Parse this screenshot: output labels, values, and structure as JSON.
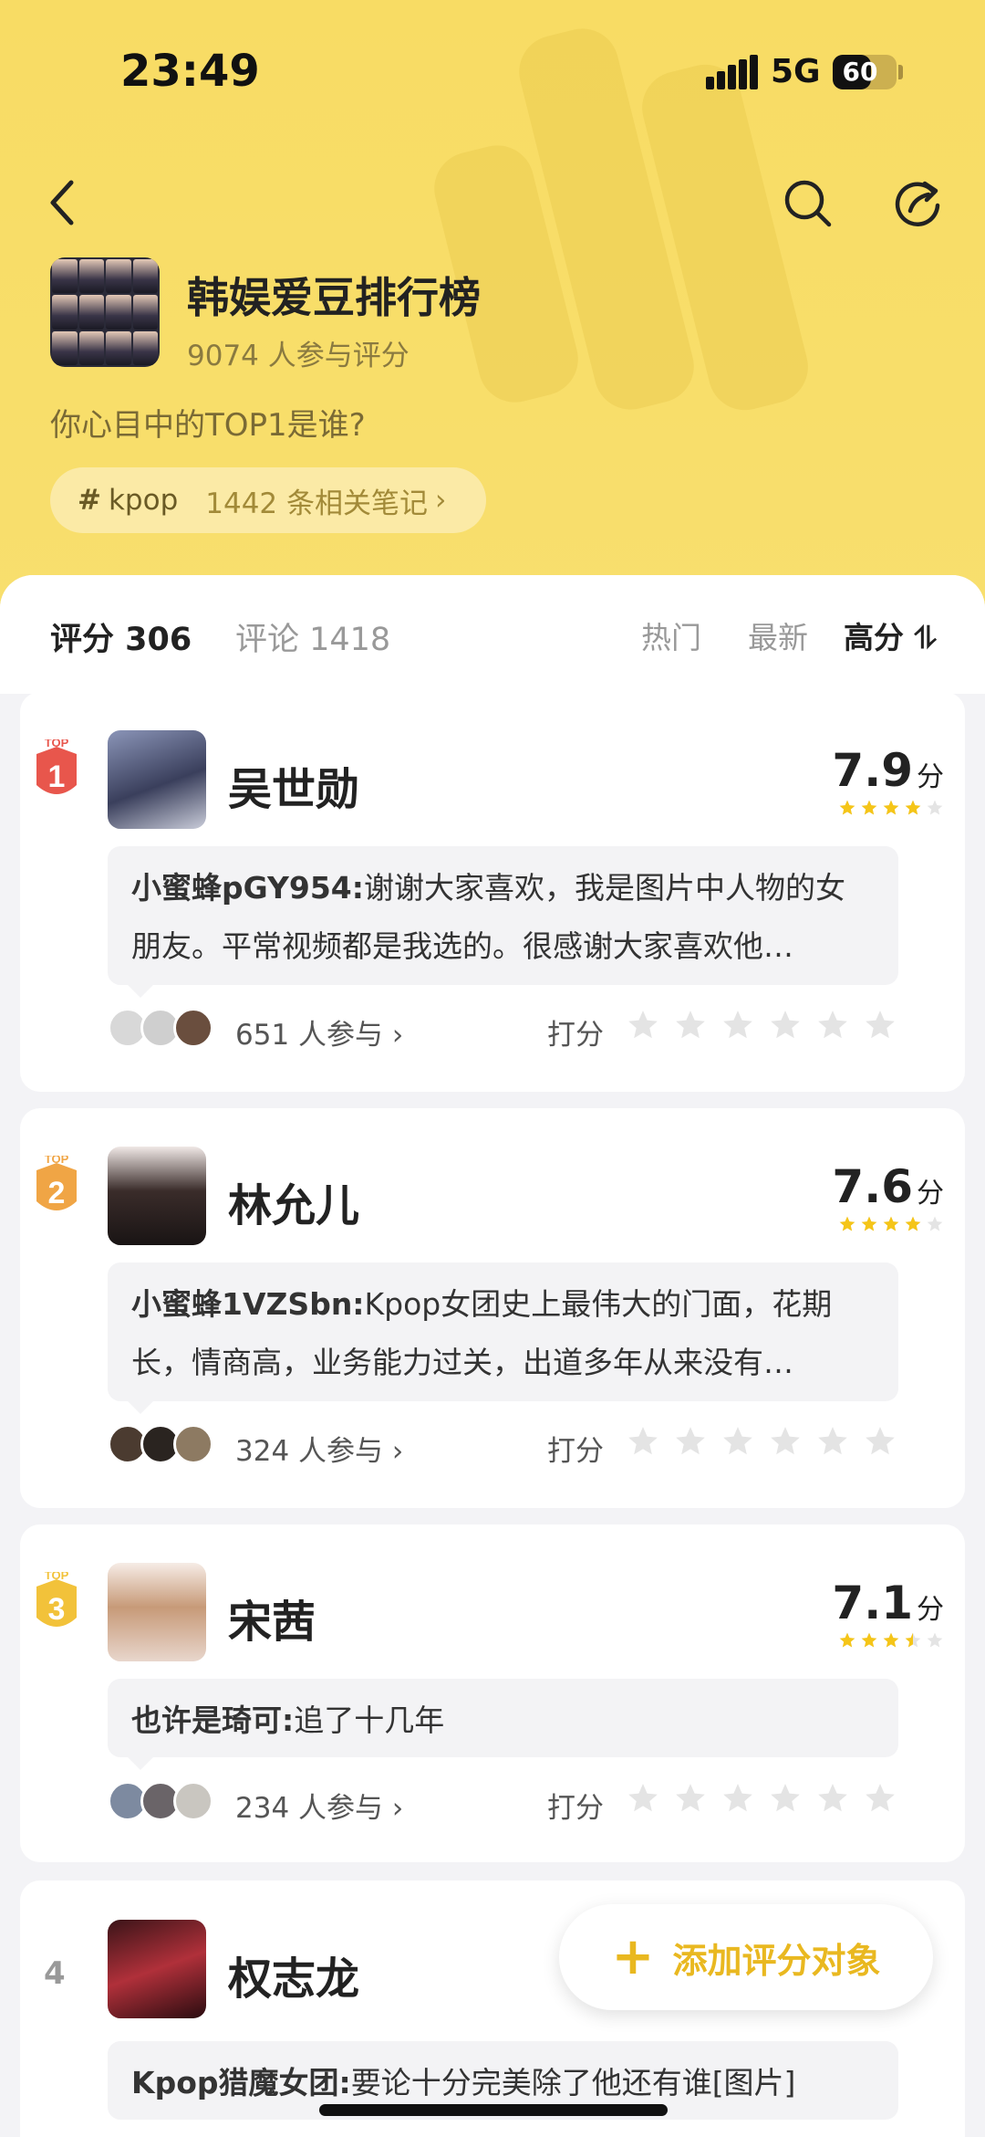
{
  "status_bar": {
    "time": "23:49",
    "network": "5G",
    "battery": "60",
    "battery_level": 0.6
  },
  "header": {
    "title": "韩娱爱豆排行榜",
    "participants": "9074 人参与评分",
    "question": "你心目中的TOP1是谁?",
    "topic_hash": "#",
    "topic_tag": "kpop",
    "topic_count": "1442 条相关笔记",
    "topic_chevron": "›"
  },
  "tabs": {
    "score": "评分 306",
    "comments": "评论 1418"
  },
  "sort": {
    "hot": "热门",
    "newest": "最新",
    "high": "高分 ⥮"
  },
  "items": [
    {
      "rank_label": "TOP",
      "rank": "1",
      "badge_color": "#e8564c",
      "name": "吴世勋",
      "score": "7.9",
      "unit": "分",
      "stars": 4,
      "comment_author": "小蜜蜂pGY954:",
      "comment_text": "谢谢大家喜欢，我是图片中人物的女朋友。平常视频都是我选的。很感谢大家喜欢他…",
      "join": "651 人参与 ›",
      "rate_label": "打分"
    },
    {
      "rank_label": "TOP",
      "rank": "2",
      "badge_color": "#f0a545",
      "name": "林允儿",
      "score": "7.6",
      "unit": "分",
      "stars": 4,
      "comment_author": "小蜜蜂1VZSbn:",
      "comment_text": "Kpop女团史上最伟大的门面，花期长，情商高，业务能力过关，出道多年从来没有…",
      "join": "324 人参与 ›",
      "rate_label": "打分"
    },
    {
      "rank_label": "TOP",
      "rank": "3",
      "badge_color": "#f2c23a",
      "name": "宋茜",
      "score": "7.1",
      "unit": "分",
      "stars": 3.5,
      "comment_author": "也许是琦可:",
      "comment_text": "追了十几年",
      "join": "234 人参与 ›",
      "rate_label": "打分"
    },
    {
      "rank": "4",
      "name": "权志龙",
      "comment_author": "Kpop猎魔女团:",
      "comment_text": "要论十分完美除了他还有谁[图片]"
    }
  ],
  "fab": {
    "plus": "+",
    "label": "添加评分对象"
  },
  "colors": {
    "accent": "#f8dc64",
    "star": "#f5c518",
    "star_empty": "#e4e4e4"
  },
  "icons": [
    "back-icon",
    "search-icon",
    "share-icon",
    "star-icon",
    "plus-icon",
    "chevron-right-icon"
  ]
}
